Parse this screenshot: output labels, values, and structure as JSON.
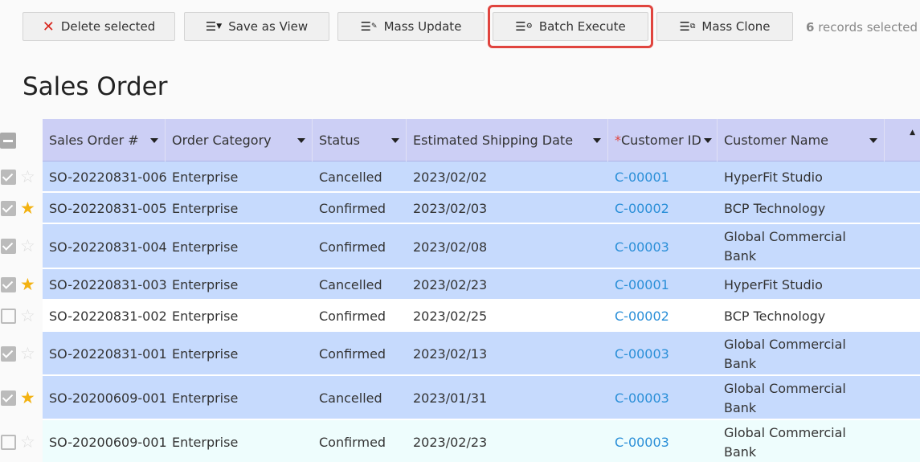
{
  "toolbar": {
    "delete_label": "Delete selected",
    "save_view_label": "Save as View",
    "mass_update_label": "Mass Update",
    "batch_execute_label": "Batch Execute",
    "mass_clone_label": "Mass Clone",
    "selected_count": "6",
    "selected_suffix": "records selected"
  },
  "page": {
    "title": "Sales Order"
  },
  "table": {
    "columns": [
      {
        "label": "Sales Order #",
        "required": ""
      },
      {
        "label": "Order Category",
        "required": ""
      },
      {
        "label": "Status",
        "required": ""
      },
      {
        "label": "Estimated Shipping Date",
        "required": ""
      },
      {
        "label": "Customer ID",
        "required": "*"
      },
      {
        "label": "Customer Name",
        "required": ""
      }
    ],
    "rows": [
      {
        "order": "SO-20220831-006",
        "category": "Enterprise",
        "status": "Cancelled",
        "date": "2023/02/02",
        "customer_id": "C-00001",
        "customer_name": "HyperFit Studio",
        "selected": true,
        "starred": false
      },
      {
        "order": "SO-20220831-005",
        "category": "Enterprise",
        "status": "Confirmed",
        "date": "2023/02/03",
        "customer_id": "C-00002",
        "customer_name": "BCP Technology",
        "selected": true,
        "starred": true
      },
      {
        "order": "SO-20220831-004",
        "category": "Enterprise",
        "status": "Confirmed",
        "date": "2023/02/08",
        "customer_id": "C-00003",
        "customer_name": "Global Commercial Bank",
        "selected": true,
        "starred": false
      },
      {
        "order": "SO-20220831-003",
        "category": "Enterprise",
        "status": "Cancelled",
        "date": "2023/02/23",
        "customer_id": "C-00001",
        "customer_name": "HyperFit Studio",
        "selected": true,
        "starred": true
      },
      {
        "order": "SO-20220831-002",
        "category": "Enterprise",
        "status": "Confirmed",
        "date": "2023/02/25",
        "customer_id": "C-00002",
        "customer_name": "BCP Technology",
        "selected": false,
        "starred": false
      },
      {
        "order": "SO-20220831-001",
        "category": "Enterprise",
        "status": "Confirmed",
        "date": "2023/02/13",
        "customer_id": "C-00003",
        "customer_name": "Global Commercial Bank",
        "selected": true,
        "starred": false
      },
      {
        "order": "SO-20200609-001",
        "category": "Enterprise",
        "status": "Cancelled",
        "date": "2023/01/31",
        "customer_id": "C-00003",
        "customer_name": "Global Commercial Bank",
        "selected": true,
        "starred": true
      },
      {
        "order": "SO-20200609-001",
        "category": "Enterprise",
        "status": "Confirmed",
        "date": "2023/02/23",
        "customer_id": "C-00003",
        "customer_name": "Global Commercial Bank",
        "selected": false,
        "starred": false
      }
    ]
  },
  "colors": {
    "highlight": "#e0443e",
    "selected_row": "#c6dafd",
    "header": "#cccff5",
    "link": "#2a8fd8",
    "star": "#f3b211"
  }
}
